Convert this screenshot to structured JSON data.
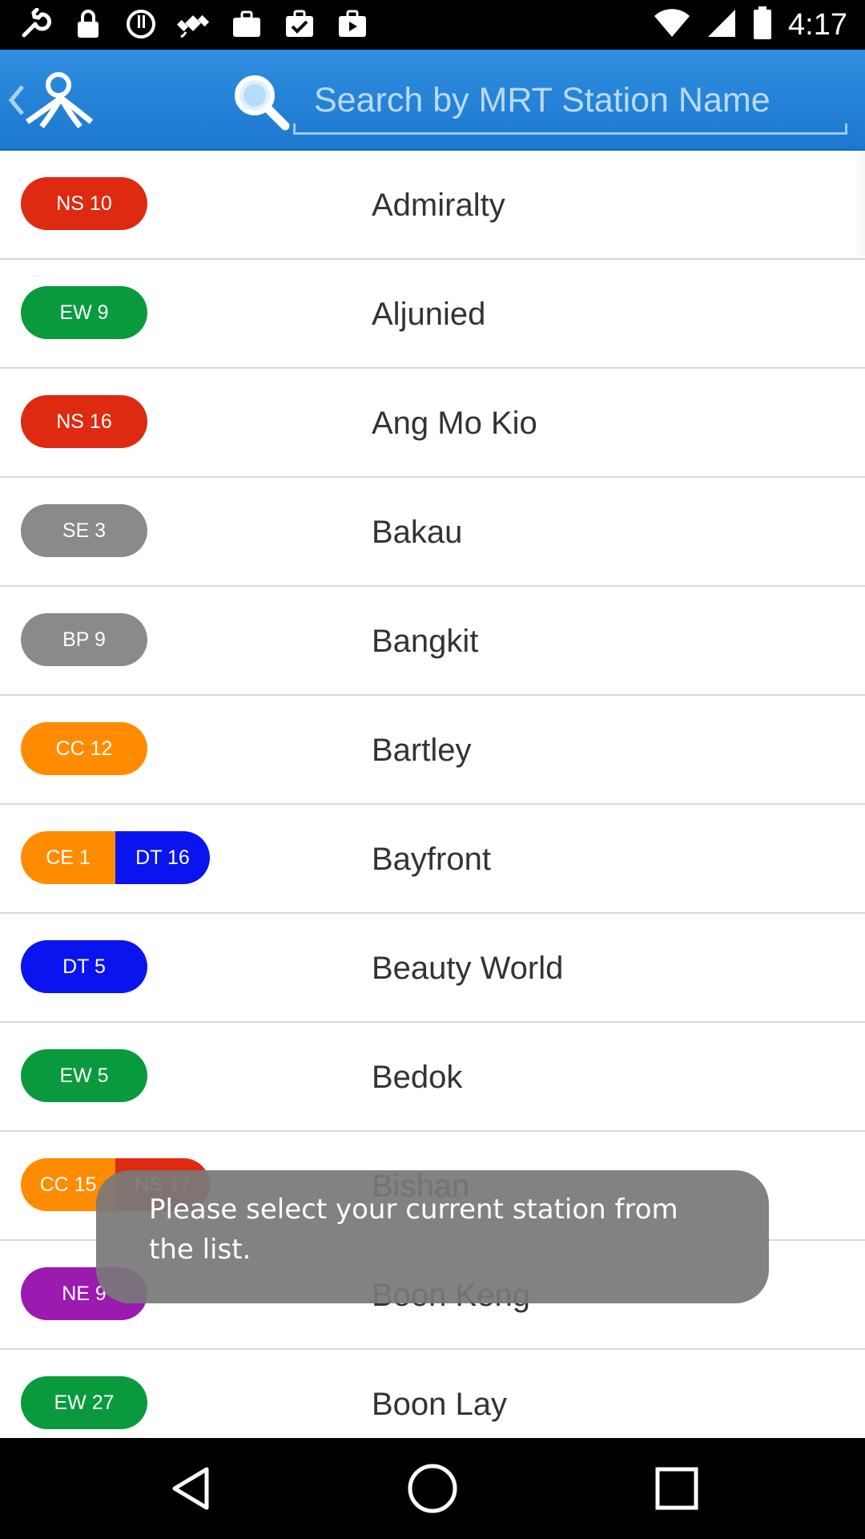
{
  "status_bar": {
    "time": "4:17",
    "left_icons": [
      "wrench-icon",
      "lock-icon",
      "alert-icon",
      "satellite-icon",
      "briefcase-icon",
      "task-icon",
      "play-store-icon"
    ],
    "right_icons": [
      "wifi-icon",
      "signal-icon",
      "battery-icon"
    ]
  },
  "header": {
    "back_icon": "chevron-left-icon",
    "logo_icon": "app-logo-icon",
    "search_icon": "search-icon",
    "search_placeholder": "Search by MRT Station Name",
    "search_value": ""
  },
  "colors": {
    "red": "#dd2a10",
    "green": "#0a9a3e",
    "grey": "#8a8a8a",
    "orange": "#ff8c00",
    "blue": "#0a14ef",
    "purple": "#9b1ab0"
  },
  "stations": [
    {
      "name": "Admiralty",
      "codes": [
        {
          "label": "NS 10",
          "color": "#dd2a10"
        }
      ]
    },
    {
      "name": "Aljunied",
      "codes": [
        {
          "label": "EW 9",
          "color": "#0a9a3e"
        }
      ]
    },
    {
      "name": "Ang Mo Kio",
      "codes": [
        {
          "label": "NS 16",
          "color": "#dd2a10"
        }
      ]
    },
    {
      "name": "Bakau",
      "codes": [
        {
          "label": "SE 3",
          "color": "#8a8a8a"
        }
      ]
    },
    {
      "name": "Bangkit",
      "codes": [
        {
          "label": "BP 9",
          "color": "#8a8a8a"
        }
      ]
    },
    {
      "name": "Bartley",
      "codes": [
        {
          "label": "CC 12",
          "color": "#ff8c00"
        }
      ]
    },
    {
      "name": "Bayfront",
      "codes": [
        {
          "label": "CE 1",
          "color": "#ff8c00"
        },
        {
          "label": "DT 16",
          "color": "#0a14ef"
        }
      ]
    },
    {
      "name": "Beauty World",
      "codes": [
        {
          "label": "DT 5",
          "color": "#0a14ef"
        }
      ]
    },
    {
      "name": "Bedok",
      "codes": [
        {
          "label": "EW 5",
          "color": "#0a9a3e"
        }
      ]
    },
    {
      "name": "Bishan",
      "codes": [
        {
          "label": "CC 15",
          "color": "#ff8c00"
        },
        {
          "label": "NS 17",
          "color": "#dd2a10"
        }
      ]
    },
    {
      "name": "Boon Keng",
      "codes": [
        {
          "label": "NE 9",
          "color": "#9b1ab0"
        }
      ]
    },
    {
      "name": "Boon Lay",
      "codes": [
        {
          "label": "EW 27",
          "color": "#0a9a3e"
        }
      ]
    }
  ],
  "toast": {
    "message": "Please select your current station from the list."
  },
  "nav_bar": {
    "buttons": [
      "back-icon",
      "home-icon",
      "recents-icon"
    ]
  }
}
